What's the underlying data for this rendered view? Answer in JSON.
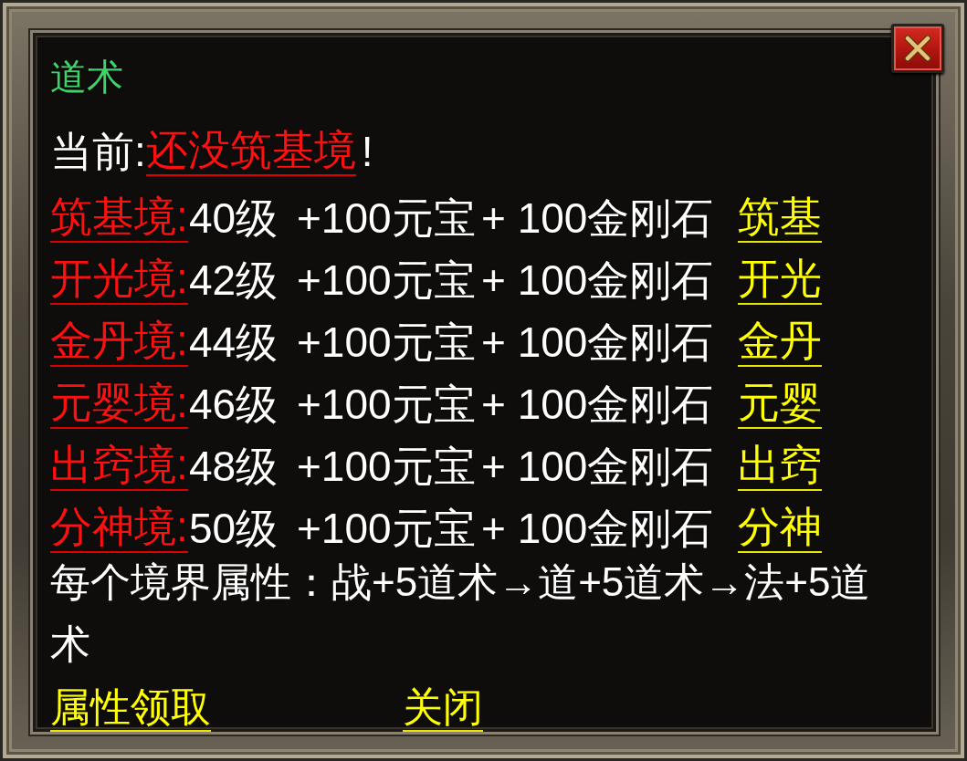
{
  "window": {
    "title": "道术"
  },
  "current": {
    "label": "当前:",
    "value": "还没筑基境",
    "suffix": "!"
  },
  "realms": [
    {
      "name": "筑基境:",
      "requirement": "40级",
      "cost_1": "+100元宝",
      "cost_2": "+ 100金刚石",
      "action": "筑基"
    },
    {
      "name": "开光境:",
      "requirement": "42级",
      "cost_1": "+100元宝",
      "cost_2": "+ 100金刚石",
      "action": "开光"
    },
    {
      "name": "金丹境:",
      "requirement": "44级",
      "cost_1": "+100元宝",
      "cost_2": "+ 100金刚石",
      "action": "金丹"
    },
    {
      "name": "元婴境:",
      "requirement": "46级",
      "cost_1": "+100元宝",
      "cost_2": "+ 100金刚石",
      "action": "元婴"
    },
    {
      "name": "出窍境:",
      "requirement": "48级",
      "cost_1": "+100元宝",
      "cost_2": "+ 100金刚石",
      "action": "出窍"
    },
    {
      "name": "分神境:",
      "requirement": "50级",
      "cost_1": "+100元宝",
      "cost_2": "+ 100金刚石",
      "action": "分神"
    }
  ],
  "description": "每个境界属性：战+5道术→道+5道术→法+5道术",
  "buttons": [
    {
      "label": "属性领取"
    },
    {
      "label": "关闭"
    }
  ]
}
